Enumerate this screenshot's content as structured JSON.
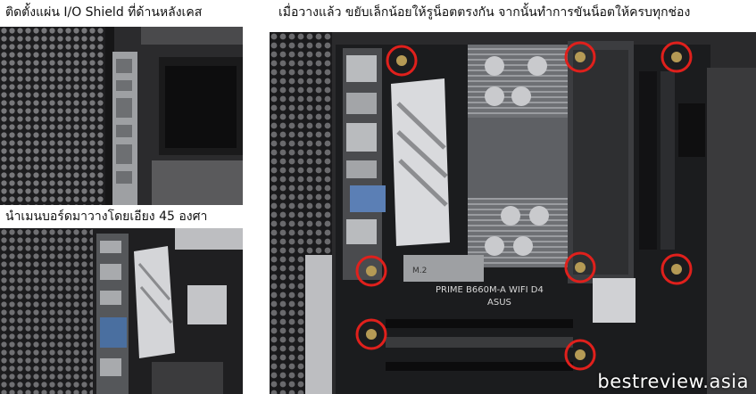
{
  "captions": {
    "top_left": "ติดตั้งแผ่น I/O Shield ที่ด้านหลังเคส",
    "bottom_left": "นำเมนบอร์ดมาวางโดยเอียง 45 องศา",
    "right": "เมื่อวางแล้ว ขยับเล็กน้อยให้รูน็อตตรงกัน จากนั้นทำการขันน็อตให้ครบทุกช่อง"
  },
  "watermark": "bestreview.asia",
  "board_text": {
    "model": "PRIME B660M-A WIFI D4",
    "brand": "ASUS",
    "m2_label": "M.2"
  },
  "screw_highlights": {
    "count": 8,
    "color": "#e0201c"
  }
}
